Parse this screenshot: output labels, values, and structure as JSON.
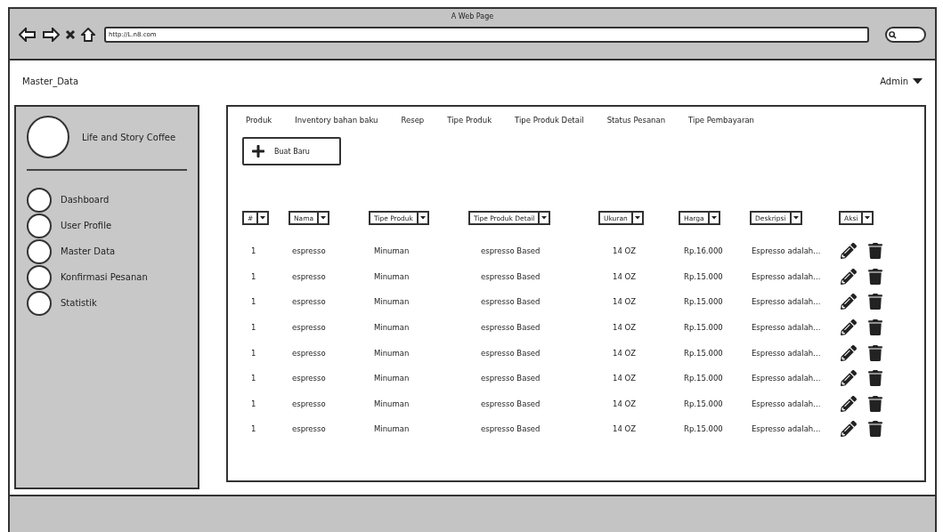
{
  "window": {
    "title": "A Web Page",
    "url": "http://L.n8.com"
  },
  "header": {
    "page_title": "Master_Data",
    "user_menu": "Admin"
  },
  "sidebar": {
    "brand": "Life and Story Coffee",
    "items": [
      {
        "label": "Dashboard"
      },
      {
        "label": "User Profile"
      },
      {
        "label": "Master Data"
      },
      {
        "label": "Konfirmasi Pesanan"
      },
      {
        "label": "Statistik"
      }
    ]
  },
  "tabs": [
    {
      "label": "Produk"
    },
    {
      "label": "Inventory bahan baku"
    },
    {
      "label": "Resep"
    },
    {
      "label": "Tipe Produk"
    },
    {
      "label": "Tipe Produk Detail"
    },
    {
      "label": "Status Pesanan"
    },
    {
      "label": "Tipe Pembayaran"
    }
  ],
  "create_button": "Buat Baru",
  "table": {
    "columns": [
      "#",
      "Nama",
      "Tipe Produk",
      "Tipe Produk Detail",
      "Ukuran",
      "Harga",
      "Deskripsi",
      "Aksi"
    ],
    "rows": [
      [
        "1",
        "espresso",
        "Minuman",
        "espresso Based",
        "14 OZ",
        "Rp.16.000",
        "Espresso adalah..."
      ],
      [
        "1",
        "espresso",
        "Minuman",
        "espresso Based",
        "14 OZ",
        "Rp.15.000",
        "Espresso adalah..."
      ],
      [
        "1",
        "espresso",
        "Minuman",
        "espresso Based",
        "14 OZ",
        "Rp.15.000",
        "Espresso adalah..."
      ],
      [
        "1",
        "espresso",
        "Minuman",
        "espresso Based",
        "14 OZ",
        "Rp.15.000",
        "Espresso adalah..."
      ],
      [
        "1",
        "espresso",
        "Minuman",
        "espresso Based",
        "14 OZ",
        "Rp.15.000",
        "Espresso adalah..."
      ],
      [
        "1",
        "espresso",
        "Minuman",
        "espresso Based",
        "14 OZ",
        "Rp.15.000",
        "Espresso adalah..."
      ],
      [
        "1",
        "espresso",
        "Minuman",
        "espresso Based",
        "14 OZ",
        "Rp.15.000",
        "Espresso adalah..."
      ],
      [
        "1",
        "espresso",
        "Minuman",
        "espresso Based",
        "14 OZ",
        "Rp.15.000",
        "Espresso adalah..."
      ]
    ]
  }
}
